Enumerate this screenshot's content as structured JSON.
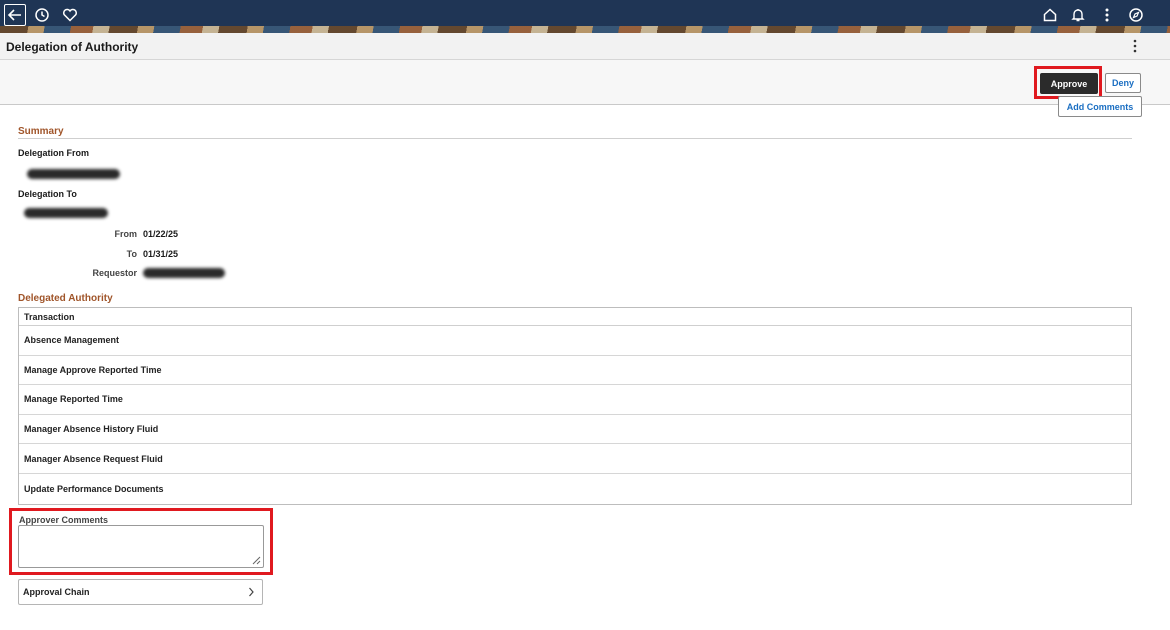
{
  "app": {
    "page_title": "Delegation of Authority",
    "icons": {
      "back": "back-arrow-icon",
      "history": "clock-icon",
      "favorites": "heart-icon",
      "home": "home-icon",
      "notifications": "bell-icon",
      "actions": "more-vertical-icon",
      "navbar": "compass-icon"
    },
    "colors": {
      "banner": "#1f3555",
      "section_heading": "#a0552a",
      "link": "#1a6ec2",
      "primary_button": "#2b2b2b",
      "highlight": "#e0191f"
    }
  },
  "actions": {
    "approve_label": "Approve",
    "deny_label": "Deny",
    "add_comments_label": "Add Comments"
  },
  "summary": {
    "heading": "Summary",
    "delegation_from_label": "Delegation From",
    "delegation_to_label": "Delegation To",
    "from_label": "From",
    "from_value": "01/22/25",
    "to_label": "To",
    "to_value": "01/31/25",
    "requestor_label": "Requestor"
  },
  "delegated_authority": {
    "heading": "Delegated Authority",
    "column_header": "Transaction",
    "rows": [
      "Absence Management",
      "Manage Approve Reported Time",
      "Manage Reported Time",
      "Manager Absence History Fluid",
      "Manager Absence Request Fluid",
      "Update Performance Documents"
    ]
  },
  "approver_comments": {
    "label": "Approver Comments",
    "value": ""
  },
  "approval_chain": {
    "label": "Approval Chain"
  }
}
